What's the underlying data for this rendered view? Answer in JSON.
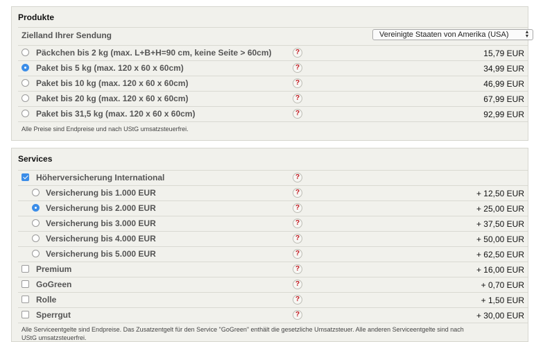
{
  "products": {
    "title": "Produkte",
    "destination_label": "Zielland Ihrer Sendung",
    "destination_value": "Vereinigte Staaten von Amerika (USA)",
    "help_glyph": "?",
    "items": [
      {
        "label": "Päckchen bis 2 kg (max. L+B+H=90 cm, keine Seite > 60cm)",
        "price": "15,79 EUR",
        "selected": false
      },
      {
        "label": "Paket bis 5 kg (max. 120 x 60 x 60cm)",
        "price": "34,99 EUR",
        "selected": true
      },
      {
        "label": "Paket bis 10 kg (max. 120 x 60 x 60cm)",
        "price": "46,99 EUR",
        "selected": false
      },
      {
        "label": "Paket bis 20 kg (max. 120 x 60 x 60cm)",
        "price": "67,99 EUR",
        "selected": false
      },
      {
        "label": "Paket bis 31,5 kg (max. 120 x 60 x 60cm)",
        "price": "92,99 EUR",
        "selected": false
      }
    ],
    "note": "Alle Preise sind Endpreise und nach UStG umsatzsteuerfrei."
  },
  "services": {
    "title": "Services",
    "insurance": {
      "label": "Höherversicherung International",
      "checked": true
    },
    "insurance_options": [
      {
        "label": "Versicherung bis 1.000 EUR",
        "price": "+ 12,50 EUR",
        "selected": false
      },
      {
        "label": "Versicherung bis 2.000 EUR",
        "price": "+ 25,00 EUR",
        "selected": true
      },
      {
        "label": "Versicherung bis 3.000 EUR",
        "price": "+ 37,50 EUR",
        "selected": false
      },
      {
        "label": "Versicherung bis 4.000 EUR",
        "price": "+ 50,00 EUR",
        "selected": false
      },
      {
        "label": "Versicherung bis 5.000 EUR",
        "price": "+ 62,50 EUR",
        "selected": false
      }
    ],
    "extras": [
      {
        "label": "Premium",
        "price": "+ 16,00 EUR",
        "checked": false
      },
      {
        "label": "GoGreen",
        "price": "+ 0,70 EUR",
        "checked": false
      },
      {
        "label": "Rolle",
        "price": "+ 1,50 EUR",
        "checked": false
      },
      {
        "label": "Sperrgut",
        "price": "+ 30,00 EUR",
        "checked": false
      }
    ],
    "note_line1": "Alle Serviceentgelte sind Endpreise. Das Zusatzentgelt für den Service \"GoGreen\" enthält die gesetzliche Umsatzsteuer. Alle anderen Serviceentgelte sind nach",
    "note_line2": "UStG umsatzsteuerfrei."
  },
  "colors": {
    "accent": "#3b8de8",
    "help": "#c0171e",
    "panel_bg": "#f1f1ec"
  }
}
